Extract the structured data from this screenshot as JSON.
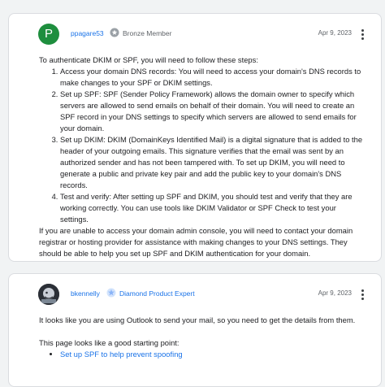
{
  "posts": [
    {
      "author": "ppagare53",
      "avatar_letter": "P",
      "avatar_color": "#1e8e3e",
      "badge": "Bronze Member",
      "badge_icon": "bronze-member-icon",
      "date": "Apr 9, 2023",
      "intro": "To authenticate DKIM or SPF, you will need to follow these steps:",
      "steps": [
        "Access your domain DNS records: You will need to access your domain's DNS records to make changes to your SPF or DKIM settings.",
        "Set up SPF: SPF (Sender Policy Framework) allows the domain owner to specify which servers are allowed to send emails on behalf of their domain. You will need to create an SPF record in your DNS settings to specify which servers are allowed to send emails for your domain.",
        "Set up DKIM: DKIM (DomainKeys Identified Mail) is a digital signature that is added to the header of your outgoing emails. This signature verifies that the email was sent by an authorized sender and has not been tampered with. To set up DKIM, you will need to generate a public and private key pair and add the public key to your domain's DNS records.",
        "Test and verify: After setting up SPF and DKIM, you should test and verify that they are working correctly. You can use tools like DKIM Validator or SPF Check to test your settings."
      ],
      "outro": "If you are unable to access your domain admin console, you will need to contact your domain registrar or hosting provider for assistance with making changes to your DNS settings. They should be able to help you set up SPF and DKIM authentication for your domain."
    },
    {
      "author": "bkennelly",
      "badge": "Diamond Product Expert",
      "badge_icon": "diamond-product-expert-icon",
      "date": "Apr 9, 2023",
      "para1": "It looks like you are using Outlook to send your mail, so you need to get the details from them.",
      "para2": "This page looks like a good starting point:",
      "link": "Set up SPF to help prevent spoofing"
    }
  ],
  "colors": {
    "link": "#1a73e8",
    "bronze": "#9aa0a6",
    "diamond": "#8ab4f8"
  }
}
